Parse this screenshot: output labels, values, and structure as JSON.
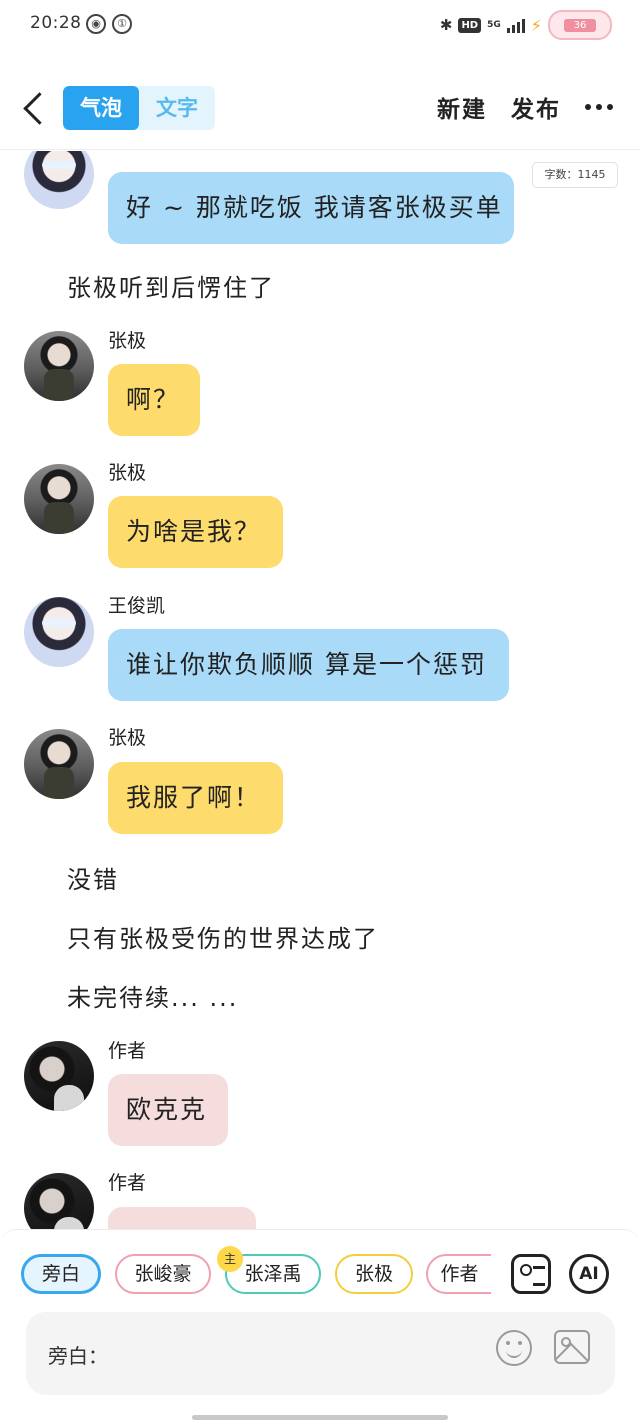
{
  "status_bar": {
    "time": "20:28",
    "network_type": "5G",
    "hd_label": "HD",
    "battery_level": "36"
  },
  "header": {
    "tabs": [
      {
        "label": "气泡",
        "active": true
      },
      {
        "label": "文字",
        "active": false
      }
    ],
    "new_label": "新建",
    "publish_label": "发布"
  },
  "chat": {
    "word_count": "字数：1145",
    "messages": [
      {
        "type": "bubble",
        "sender": "",
        "text": "好 ~ 那就吃饭 我请客张极买单",
        "color": "#a9daf8"
      },
      {
        "type": "narration",
        "text": "张极听到后愣住了"
      },
      {
        "type": "bubble",
        "sender": "张极",
        "text": "啊？",
        "color": "#fedb6d"
      },
      {
        "type": "bubble",
        "sender": "张极",
        "text": "为啥是我？",
        "color": "#fedb6d"
      },
      {
        "type": "bubble",
        "sender": "王俊凯",
        "text": "谁让你欺负顺顺 算是一个惩罚",
        "color": "#a9daf8"
      },
      {
        "type": "bubble",
        "sender": "张极",
        "text": "我服了啊！",
        "color": "#fedb6d"
      },
      {
        "type": "narration",
        "text": "没错"
      },
      {
        "type": "narration",
        "text": "只有张极受伤的世界达成了"
      },
      {
        "type": "narration",
        "text": "未完待续... ..."
      },
      {
        "type": "bubble",
        "sender": "作者",
        "text": "欧克克",
        "color": "#f5dddd"
      },
      {
        "type": "bubble",
        "sender": "作者",
        "text": "",
        "color": "#f5dddd"
      }
    ]
  },
  "roles": [
    {
      "label": "旁白",
      "selected": true,
      "border": "#37a7ef"
    },
    {
      "label": "张峻豪",
      "selected": false,
      "border": "#f0a0b0"
    },
    {
      "label": "张泽禹",
      "selected": false,
      "border": "#4cc9b8",
      "badge": "主"
    },
    {
      "label": "张极",
      "selected": false,
      "border": "#f2cf3a"
    },
    {
      "label": "作者",
      "selected": false,
      "border": "#f0a0b0"
    }
  ],
  "tools": {
    "ai_label": "AI",
    "card_icon": "contact-card-icon"
  },
  "input": {
    "label": "旁白："
  }
}
